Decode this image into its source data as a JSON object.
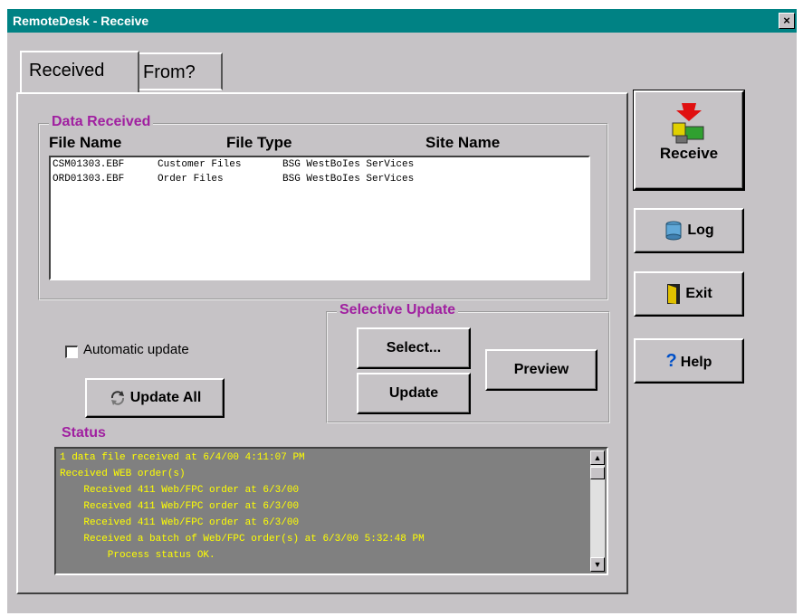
{
  "window": {
    "title": "RemoteDesk - Receive",
    "close_symbol": "×"
  },
  "tabs": [
    {
      "label": "Received",
      "active": true
    },
    {
      "label": "From?",
      "active": false
    }
  ],
  "data_received": {
    "group_label": "Data Received",
    "columns": [
      "File Name",
      "File Type",
      "Site Name"
    ],
    "rows": [
      {
        "file_name": "CSM01303.EBF",
        "file_type": "Customer Files",
        "site_name": "BSG WestBoIes SerVices"
      },
      {
        "file_name": "ORD01303.EBF",
        "file_type": "Order Files",
        "site_name": "BSG WestBoIes SerVices"
      }
    ]
  },
  "automatic_update": {
    "label": "Automatic update",
    "checked": false
  },
  "update_all_button": {
    "label": "Update All"
  },
  "selective_update": {
    "group_label": "Selective Update",
    "select_label": "Select...",
    "update_label": "Update",
    "preview_label": "Preview"
  },
  "status": {
    "group_label": "Status",
    "lines": [
      "1 data file received at 6/4/00 4:11:07 PM",
      "Received WEB order(s)",
      "    Received 411 Web/FPC order at 6/3/00",
      "    Received 411 Web/FPC order at 6/3/00",
      "    Received 411 Web/FPC order at 6/3/00",
      "    Received a batch of Web/FPC order(s) at 6/3/00 5:32:48 PM",
      "        Process status OK."
    ]
  },
  "side_buttons": {
    "receive": "Receive",
    "log": "Log",
    "exit": "Exit",
    "help": "Help"
  },
  "icons": {
    "receive": "receive-download-icon",
    "log": "database-log-icon",
    "exit": "door-exit-icon",
    "help": "question-mark-icon",
    "update_all": "update-arrows-icon"
  },
  "colors": {
    "titlebar": "#008284",
    "group_label": "#a020a0",
    "status_bg": "#808080",
    "status_text": "#ffff00"
  }
}
